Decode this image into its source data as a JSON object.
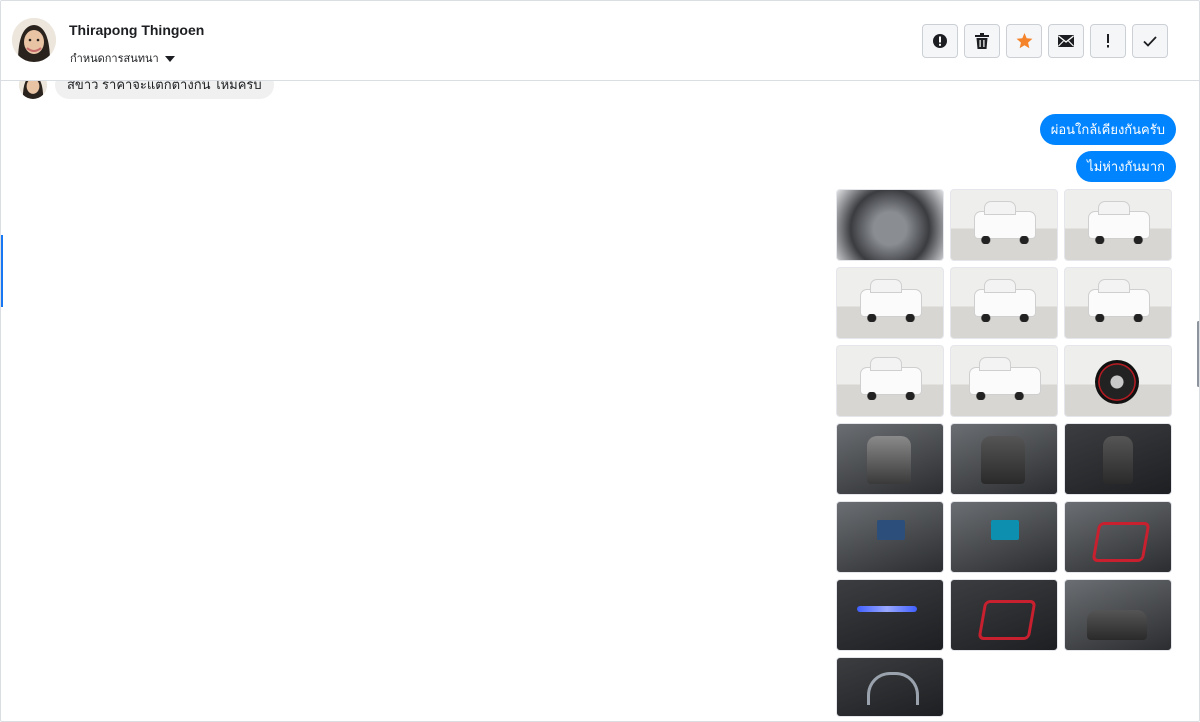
{
  "header": {
    "contact_name": "Thirapong Thingoen",
    "stage_label": "กำหนดการสนทนา",
    "actions": [
      {
        "name": "spam",
        "icon": "alert-circle-icon"
      },
      {
        "name": "delete",
        "icon": "trash-icon"
      },
      {
        "name": "star",
        "icon": "star-icon",
        "color": "#f5832a"
      },
      {
        "name": "mark-unread",
        "icon": "envelope-icon"
      },
      {
        "name": "important",
        "icon": "exclamation-icon"
      },
      {
        "name": "done",
        "icon": "check-icon"
      }
    ]
  },
  "thread": {
    "previous_message": "สีขาว ราคาจะแตกต่างกัน ไหมครับ",
    "outgoing": [
      "ผ่อนใกล้เคียงกันครับ",
      "ไม่ห่างกันมาก"
    ],
    "photo_count": 19,
    "photos": [
      "engine",
      "front",
      "front",
      "front-side",
      "rear",
      "rear-side",
      "rear-side",
      "side",
      "wheel",
      "door-interior",
      "seat",
      "gear",
      "dashboard",
      "console",
      "seat-red",
      "led-floor",
      "red-trim",
      "cabin",
      "gauges"
    ]
  },
  "colors": {
    "outgoing_bubble": "#0084ff",
    "incoming_bubble": "#f0f0f0",
    "accent": "#1877f2",
    "star": "#f5832a"
  }
}
